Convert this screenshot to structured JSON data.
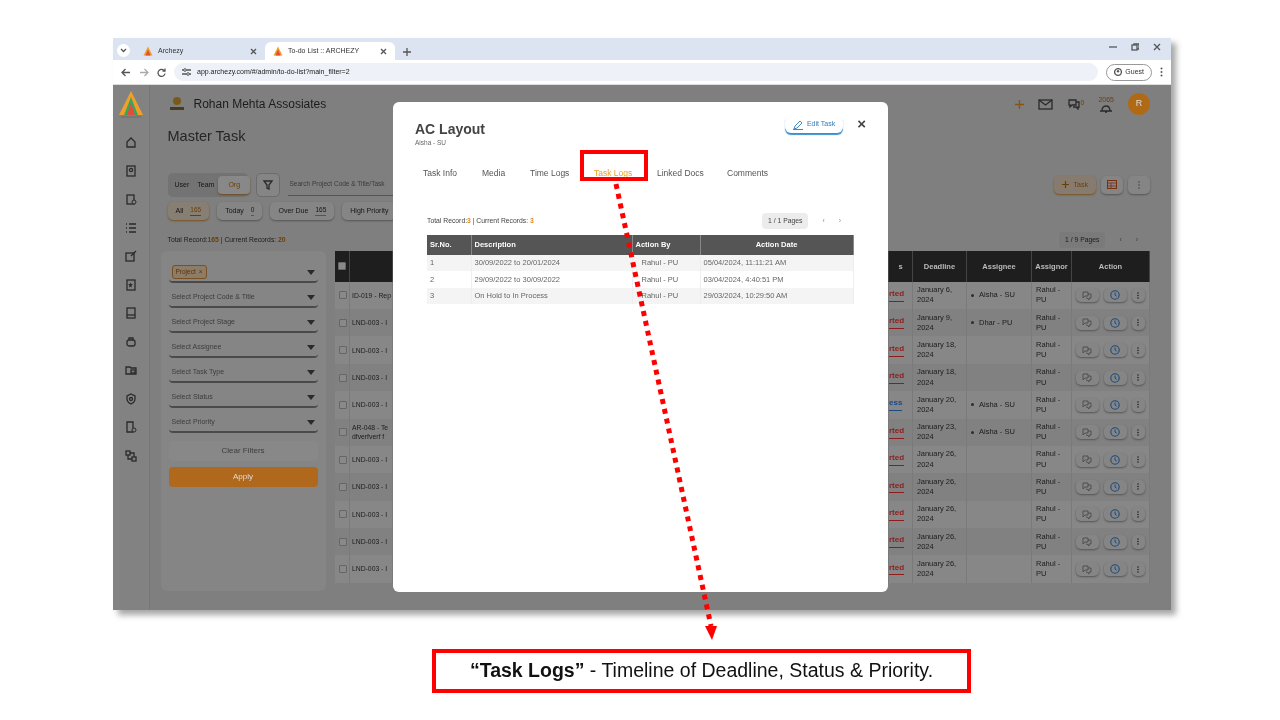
{
  "browser": {
    "tabs": [
      {
        "title": "Archezy",
        "selected": false
      },
      {
        "title": "To-do List :: ARCHEZY",
        "selected": true
      }
    ],
    "url": "app.archezy.com/#/admin/to-do-list?main_filter=2",
    "profile": "Guest"
  },
  "app": {
    "company": "Rohan Mehta Assosiates",
    "messages_count": "0",
    "alerts_count": "2065",
    "avatar": "R",
    "page_title": "Master Task",
    "scope": [
      {
        "label": "User",
        "selected": false
      },
      {
        "label": "Team",
        "selected": false
      },
      {
        "label": "Org",
        "selected": true
      }
    ],
    "search": {
      "placeholder": "Search Project Code & Title/Task"
    },
    "add_task": "Task",
    "quick_filters": [
      {
        "label": "All",
        "count": "165",
        "selected": true
      },
      {
        "label": "Today",
        "count": "0",
        "selected": false
      },
      {
        "label": "Over Due",
        "count": "165",
        "selected": false
      },
      {
        "label": "High Priority",
        "selected": false
      }
    ],
    "summary": {
      "total_label": "Total Record:",
      "total": "165",
      "current_label": "| Current Records:",
      "current": "20"
    },
    "pagination": {
      "pages": "1 / 9 Pages",
      "prev": "‹",
      "next": "›"
    },
    "filters": [
      {
        "kind": "tag",
        "tag": "Project",
        "remove": "×"
      },
      {
        "kind": "select",
        "placeholder": "Select Project Code & Title"
      },
      {
        "kind": "select",
        "placeholder": "Select Project Stage"
      },
      {
        "kind": "select",
        "placeholder": "Select Assignee"
      },
      {
        "kind": "select",
        "placeholder": "Select Task Type"
      },
      {
        "kind": "select",
        "placeholder": "Select Status"
      },
      {
        "kind": "select",
        "placeholder": "Select Priority"
      }
    ],
    "clear_button": "Clear Filters",
    "apply_button": "Apply",
    "table": {
      "select_all": false,
      "columns": [
        "s",
        "Deadline",
        "Assignee",
        "Assignor",
        "Action"
      ],
      "rows": [
        {
          "task": "ID-019 - Rep",
          "selected": false,
          "status": "rted",
          "color": "#8e1c1c",
          "deadline": "January 6, 2024",
          "assignee": "Aisha - SU",
          "assignor": "Rahul - PU"
        },
        {
          "task": "LND-003 - I",
          "selected": false,
          "status": "rted",
          "color": "#8e1c1c",
          "deadline": "January 9, 2024",
          "assignee": "Dhar - PU",
          "assignor": "Rahul - PU"
        },
        {
          "task": "LND-003 - I",
          "selected": false,
          "status": "rted",
          "color": "#8e1c1c",
          "deadline": "January 18, 2024",
          "assignor": "Rahul - PU"
        },
        {
          "task": "LND-003 - I",
          "selected": false,
          "status": "rted",
          "color": "#8e1c1c",
          "deadline": "January 18, 2024",
          "assignor": "Rahul - PU"
        },
        {
          "task": "LND-003 - I",
          "selected": false,
          "status": "ess",
          "color": "#1b4a85",
          "deadline": "January 20, 2024",
          "assignee": "Aisha - SU",
          "assignor": "Rahul - PU"
        },
        {
          "task": "AR-048 - Te dfverfverf f",
          "selected": false,
          "status": "rted",
          "color": "#8e1c1c",
          "deadline": "January 23, 2024",
          "assignee": "Aisha - SU",
          "assignor": "Rahul - PU"
        },
        {
          "task": "LND-003 - I",
          "selected": false,
          "status": "rted",
          "color": "#8e1c1c",
          "deadline": "January 26, 2024",
          "assignor": "Rahul - PU"
        },
        {
          "task": "LND-003 - I",
          "selected": false,
          "status": "rted",
          "color": "#8e1c1c",
          "deadline": "January 26, 2024",
          "assignor": "Rahul - PU"
        },
        {
          "task": "LND-003 - I",
          "selected": false,
          "status": "rted",
          "color": "#8e1c1c",
          "deadline": "January 26, 2024",
          "assignor": "Rahul - PU"
        },
        {
          "task": "LND-003 - I",
          "selected": false,
          "status": "rted",
          "color": "#8e1c1c",
          "deadline": "January 26, 2024",
          "assignor": "Rahul - PU"
        },
        {
          "task": "LND-003 - I",
          "selected": false,
          "status": "rted",
          "color": "#8e1c1c",
          "deadline": "January 26, 2024",
          "assignor": "Rahul - PU"
        }
      ]
    }
  },
  "modal": {
    "title": "AC Layout",
    "subtitle": "Aisha - SU",
    "edit_button": "Edit Task",
    "close": "×",
    "tabs": [
      {
        "label": "Task Info",
        "selected": false
      },
      {
        "label": "Media",
        "selected": false
      },
      {
        "label": "Time Logs",
        "selected": false
      },
      {
        "label": "Task Logs",
        "selected": true
      },
      {
        "label": "Linked Docs",
        "selected": false
      },
      {
        "label": "Comments",
        "selected": false
      }
    ],
    "summary": {
      "total_label": "Total Record:",
      "total": "3",
      "current_label": "| Current Records:",
      "current": "3"
    },
    "pagination": {
      "pages": "1 / 1 Pages",
      "prev": "‹",
      "next": "›"
    },
    "logs": {
      "columns": [
        "Sr.No.",
        "Description",
        "Action By",
        "Action Date"
      ],
      "rows": [
        {
          "sr": "1",
          "description": "30/09/2022 to 20/01/2024",
          "action_by": "Rahul - PU",
          "action_date": "05/04/2024, 11:11:21 AM"
        },
        {
          "sr": "2",
          "description": "29/09/2022 to 30/09/2022",
          "action_by": "Rahul - PU",
          "action_date": "03/04/2024, 4:40:51 PM"
        },
        {
          "sr": "3",
          "description": "On Hold to In Process",
          "action_by": "Rahul - PU",
          "action_date": "29/03/2024, 10:29:50 AM"
        }
      ]
    }
  },
  "callout": {
    "text": "**“Task Logs”** - Timeline of Deadline, Status & Priority."
  }
}
